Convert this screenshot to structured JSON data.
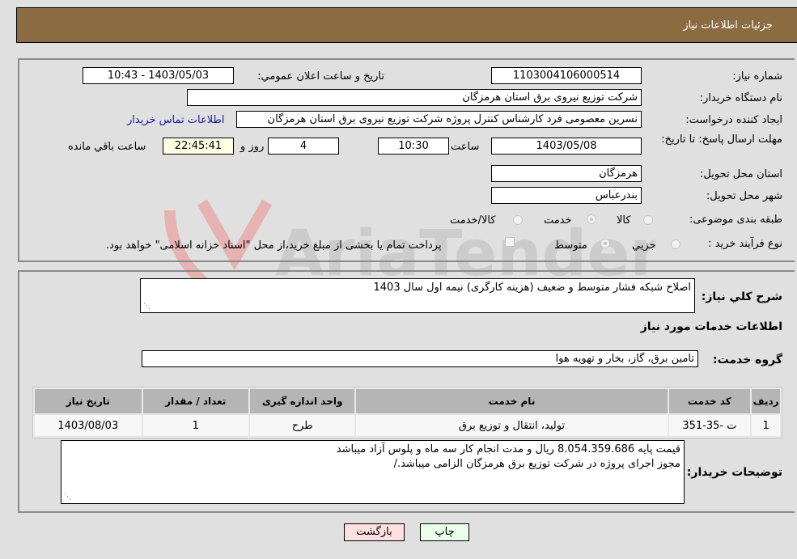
{
  "header": {
    "title": "جزئیات اطلاعات نیاز"
  },
  "details": {
    "need_number_label": "شماره نیاز:",
    "need_number": "1103004106000514",
    "announce_label": "تاریخ و ساعت اعلان عمومي:",
    "announce_value": "1403/05/03 - 10:43",
    "buyer_org_label": "نام دستگاه خریدار:",
    "buyer_org": "شرکت توزیع نیروی برق استان هرمزگان",
    "creator_label": "ایجاد کننده درخواست:",
    "creator": "نسرین معصومی فرد کارشناس کنترل پروژه شرکت توزیع نیروی برق استان هرمزگان",
    "contact_link": "اطلاعات تماس خریدار",
    "deadline_label": "مهلت ارسال پاسخ: تا تاریخ:",
    "deadline_date": "1403/05/08",
    "time_label": "ساعت",
    "deadline_time": "10:30",
    "days": "4",
    "days_label": "روز و",
    "remaining_time": "22:45:41",
    "remaining_label": "ساعت باقي مانده",
    "province_label": "استان محل تحویل:",
    "province": "هرمزگان",
    "city_label": "شهر محل تحویل:",
    "city": "بندرعباس",
    "category_label": "طبقه بندی موضوعی:",
    "category_options": [
      "کالا",
      "خدمت",
      "کالا/خدمت"
    ],
    "category_selected": "خدمت",
    "process_label": "نوع فرآیند خرید :",
    "process_options": [
      "جزيي",
      "متوسط"
    ],
    "process_selected": "متوسط",
    "treasury_note": "پرداخت تمام یا بخشی از مبلغ خرید،از محل \"اسناد خزانه اسلامی\" خواهد بود."
  },
  "summary": {
    "description_label": "شرح کلي نیاز:",
    "description": "اصلاح شبکه فشار متوسط و ضعیف (هزینه کارگری) نیمه اول سال 1403",
    "services_heading": "اطلاعات خدمات مورد نیاز",
    "service_group_label": "گروه خدمت:",
    "service_group": "تامین برق، گاز، بخار و تهویه هوا"
  },
  "table": {
    "headers": [
      "ردیف",
      "کد خدمت",
      "نام خدمت",
      "واحد اندازه گیری",
      "تعداد / مقدار",
      "تاریخ نیاز"
    ],
    "rows": [
      [
        "1",
        "ت -35-351",
        "تولید، انتقال و توزیع برق",
        "طرح",
        "1",
        "1403/08/03"
      ]
    ]
  },
  "buyer_notes": {
    "label": "توضیحات خریدار:",
    "line1": "قیمت پایه 8.054.359.686 ریال و مدت انجام کار سه ماه و پلوس آزاد میباشد",
    "line2": "مجوز اجرای پروژه در شرکت توزیع برق هرمزگان الزامی میباشد./"
  },
  "buttons": {
    "print": "چاپ",
    "back": "بازگشت"
  },
  "watermark": {
    "text": "AriaTender.neT"
  }
}
